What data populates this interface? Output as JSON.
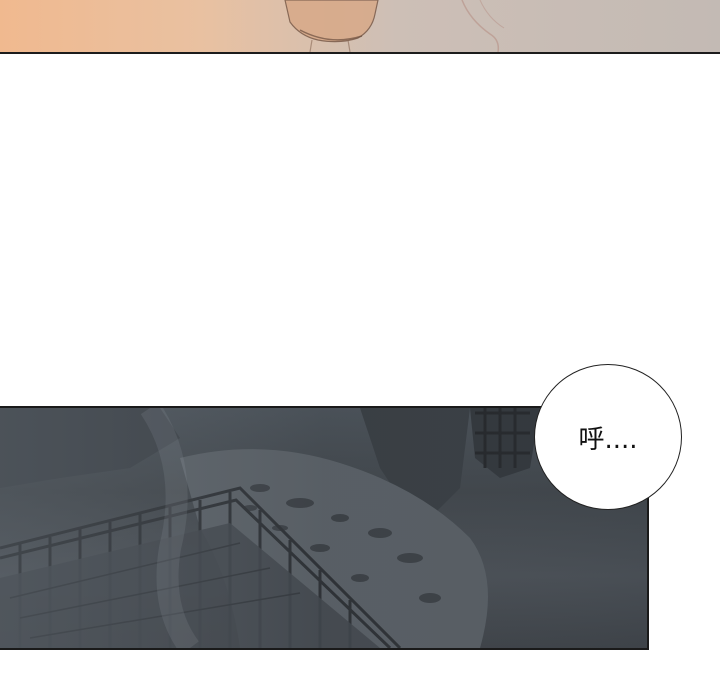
{
  "panels": {
    "top": {
      "description_icon": "scene-fragment-illustration"
    },
    "bottom": {
      "description_icon": "ruined-staircase-illustration"
    }
  },
  "speech_bubble": {
    "text": "呼...."
  },
  "colors": {
    "top_panel_warm": "#f0b98f",
    "top_panel_cool": "#c3bab4",
    "bottom_panel_dark": "#2f3439",
    "border": "#1c1c1c"
  }
}
